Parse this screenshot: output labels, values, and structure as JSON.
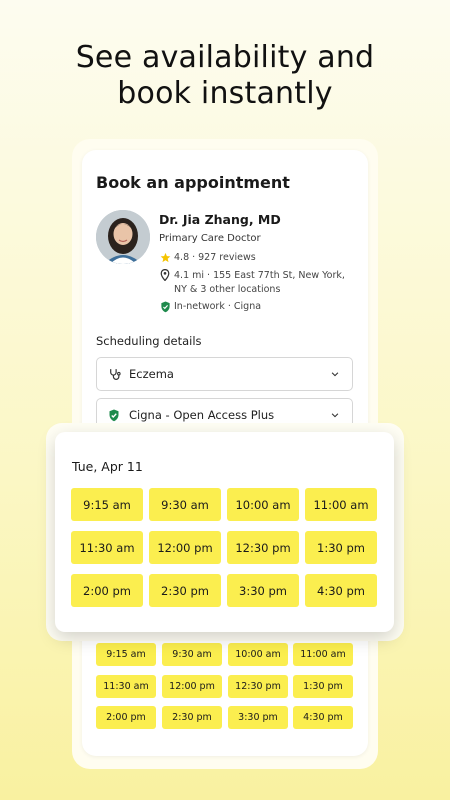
{
  "headline": {
    "line1": "See availability and",
    "line2": "book instantly"
  },
  "card": {
    "title": "Book an appointment",
    "doctor": {
      "name": "Dr. Jia Zhang, MD",
      "specialty": "Primary Care Doctor",
      "rating": "4.8",
      "reviews": "927 reviews",
      "location_line1": "4.1 mi · 155 East 77th St, New York,",
      "location_line2": "NY & 3 other locations",
      "network": "In-network · Cigna"
    },
    "scheduling_label": "Scheduling details",
    "reason_select": "Eczema",
    "insurance_select": "Cigna - Open Access Plus"
  },
  "popup": {
    "date": "Tue, Apr 11",
    "slots": [
      "9:15 am",
      "9:30 am",
      "10:00 am",
      "11:00 am",
      "11:30 am",
      "12:00 pm",
      "12:30 pm",
      "1:30 pm",
      "2:00 pm",
      "2:30 pm",
      "3:30 pm",
      "4:30 pm"
    ]
  },
  "background_slots": [
    "9:15 am",
    "9:30 am",
    "10:00 am",
    "11:00 am",
    "11:30 am",
    "12:00 pm",
    "12:30 pm",
    "1:30 pm",
    "2:00 pm",
    "2:30 pm",
    "3:30 pm",
    "4:30 pm"
  ],
  "colors": {
    "slot_yellow": "#fbee4f",
    "network_green": "#1e8a4c",
    "star_yellow": "#f5c400"
  }
}
